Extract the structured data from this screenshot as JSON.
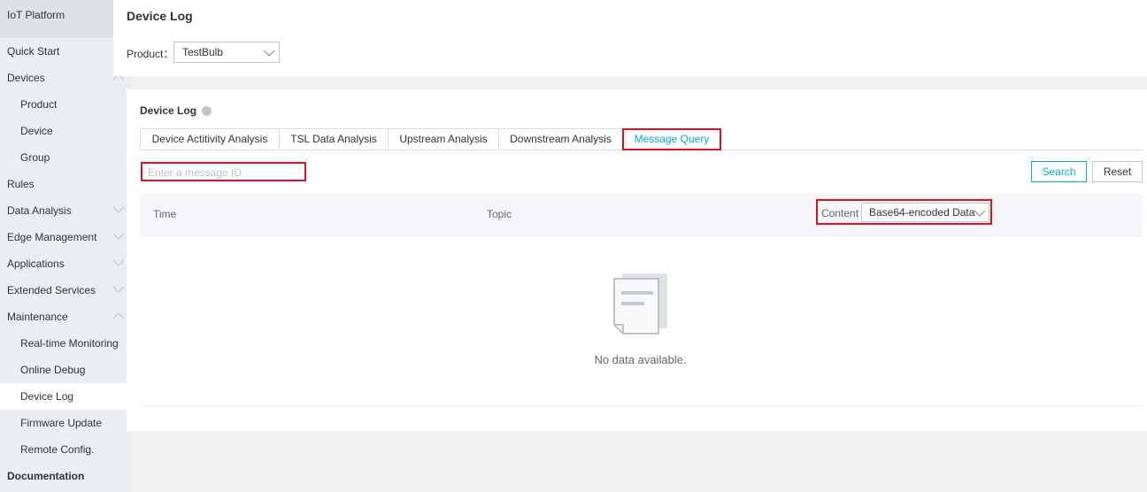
{
  "sidebar": {
    "title": "IoT Platform",
    "items": [
      {
        "label": "Quick Start"
      },
      {
        "label": "Devices"
      },
      {
        "label": "Product"
      },
      {
        "label": "Device"
      },
      {
        "label": "Group"
      },
      {
        "label": "Rules"
      },
      {
        "label": "Data Analysis"
      },
      {
        "label": "Edge Management"
      },
      {
        "label": "Applications"
      },
      {
        "label": "Extended Services"
      },
      {
        "label": "Maintenance"
      },
      {
        "label": "Real-time Monitoring"
      },
      {
        "label": "Online Debug"
      },
      {
        "label": "Device Log"
      },
      {
        "label": "Firmware Update"
      },
      {
        "label": "Remote Config."
      },
      {
        "label": "Documentation"
      }
    ]
  },
  "header": {
    "title": "Device Log",
    "product_label": "Product：",
    "product_value": "TestBulb"
  },
  "panel": {
    "title": "Device Log",
    "tabs": [
      {
        "label": "Device Actitivity Analysis"
      },
      {
        "label": "TSL Data Analysis"
      },
      {
        "label": "Upstream Analysis"
      },
      {
        "label": "Downstream Analysis"
      },
      {
        "label": "Message Query"
      }
    ],
    "search": {
      "placeholder": "Enter a message ID",
      "value": ""
    },
    "search_button": "Search",
    "reset_button": "Reset",
    "table": {
      "columns": {
        "time": "Time",
        "topic": "Topic",
        "content": "Content"
      },
      "content_format": "Base64-encoded Data"
    },
    "empty_text": "No data available."
  },
  "colors": {
    "accent": "#00b0ce",
    "highlight_border": "#e0101d",
    "sidebar_bg": "#eaedf1"
  }
}
